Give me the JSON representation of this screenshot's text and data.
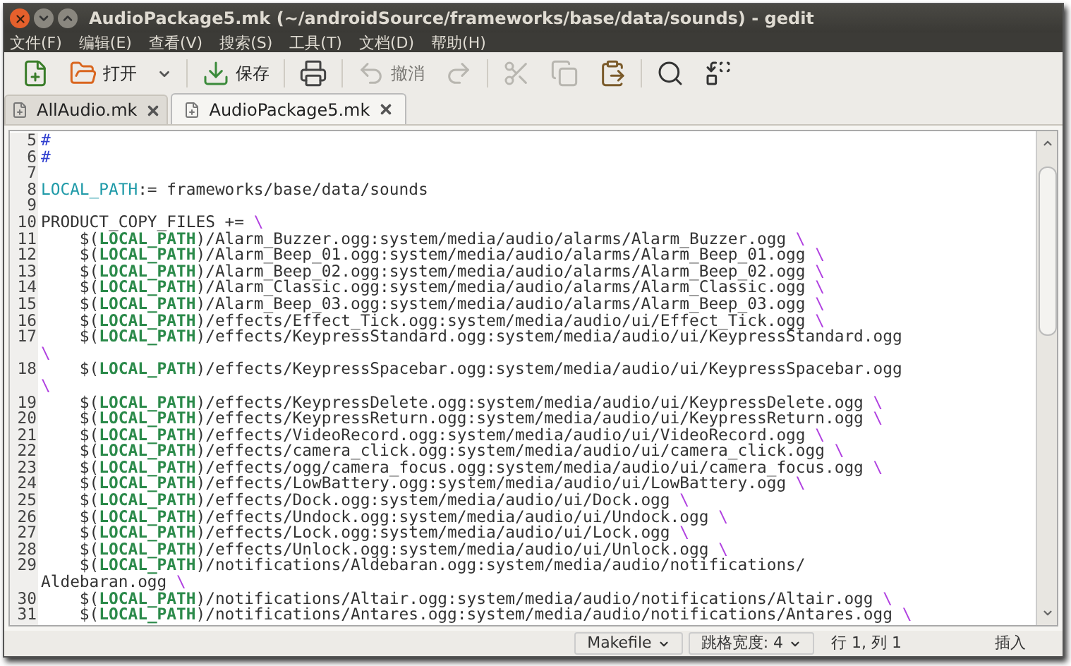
{
  "window": {
    "title": "AudioPackage5.mk (~/androidSource/frameworks/base/data/sounds) - gedit"
  },
  "menu": [
    "文件(F)",
    "编辑(E)",
    "查看(V)",
    "搜索(S)",
    "工具(T)",
    "文档(D)",
    "帮助(H)"
  ],
  "toolbar": [
    {
      "disabled": false
    },
    {
      "label": "打开",
      "disabled": false
    },
    {
      "disabled": false
    },
    {
      "label": "保存",
      "disabled": false
    },
    {
      "disabled": false
    },
    {
      "label": "撤消",
      "disabled": true
    },
    {
      "disabled": true
    },
    {
      "disabled": true
    },
    {
      "disabled": true
    },
    {
      "disabled": false
    },
    {
      "disabled": false
    },
    {
      "disabled": false
    }
  ],
  "tabs": [
    {
      "label": "AllAudio.mk",
      "selected": false
    },
    {
      "label": "AudioPackage5.mk",
      "selected": true
    }
  ],
  "editor": {
    "rows": [
      {
        "number": "5",
        "segments": [
          {
            "kind": "comment",
            "text": "#"
          }
        ]
      },
      {
        "number": "6",
        "segments": [
          {
            "kind": "comment",
            "text": "#"
          }
        ]
      },
      {
        "number": "7",
        "segments": []
      },
      {
        "number": "8",
        "segments": [
          {
            "kind": "variable",
            "text": "LOCAL_PATH"
          },
          {
            "kind": "plain",
            "text": ":= frameworks/base/data/sounds"
          }
        ]
      },
      {
        "number": "9",
        "segments": []
      },
      {
        "number": "10",
        "segments": [
          {
            "kind": "plain",
            "text": "PRODUCT_COPY_FILES += "
          },
          {
            "kind": "escape",
            "text": "\\"
          }
        ]
      },
      {
        "number": "11",
        "segments": [
          {
            "kind": "plain",
            "text": "    $("
          },
          {
            "kind": "macro",
            "text": "LOCAL_PATH"
          },
          {
            "kind": "plain",
            "text": ")/Alarm_Buzzer.ogg:system/media/audio/alarms/Alarm_Buzzer.ogg "
          },
          {
            "kind": "escape",
            "text": "\\"
          }
        ]
      },
      {
        "number": "12",
        "segments": [
          {
            "kind": "plain",
            "text": "    $("
          },
          {
            "kind": "macro",
            "text": "LOCAL_PATH"
          },
          {
            "kind": "plain",
            "text": ")/Alarm_Beep_01.ogg:system/media/audio/alarms/Alarm_Beep_01.ogg "
          },
          {
            "kind": "escape",
            "text": "\\"
          }
        ]
      },
      {
        "number": "13",
        "segments": [
          {
            "kind": "plain",
            "text": "    $("
          },
          {
            "kind": "macro",
            "text": "LOCAL_PATH"
          },
          {
            "kind": "plain",
            "text": ")/Alarm_Beep_02.ogg:system/media/audio/alarms/Alarm_Beep_02.ogg "
          },
          {
            "kind": "escape",
            "text": "\\"
          }
        ]
      },
      {
        "number": "14",
        "segments": [
          {
            "kind": "plain",
            "text": "    $("
          },
          {
            "kind": "macro",
            "text": "LOCAL_PATH"
          },
          {
            "kind": "plain",
            "text": ")/Alarm_Classic.ogg:system/media/audio/alarms/Alarm_Classic.ogg "
          },
          {
            "kind": "escape",
            "text": "\\"
          }
        ]
      },
      {
        "number": "15",
        "segments": [
          {
            "kind": "plain",
            "text": "    $("
          },
          {
            "kind": "macro",
            "text": "LOCAL_PATH"
          },
          {
            "kind": "plain",
            "text": ")/Alarm_Beep_03.ogg:system/media/audio/alarms/Alarm_Beep_03.ogg "
          },
          {
            "kind": "escape",
            "text": "\\"
          }
        ]
      },
      {
        "number": "16",
        "segments": [
          {
            "kind": "plain",
            "text": "    $("
          },
          {
            "kind": "macro",
            "text": "LOCAL_PATH"
          },
          {
            "kind": "plain",
            "text": ")/effects/Effect_Tick.ogg:system/media/audio/ui/Effect_Tick.ogg "
          },
          {
            "kind": "escape",
            "text": "\\"
          }
        ]
      },
      {
        "number": "17",
        "segments": [
          {
            "kind": "plain",
            "text": "    $("
          },
          {
            "kind": "macro",
            "text": "LOCAL_PATH"
          },
          {
            "kind": "plain",
            "text": ")/effects/KeypressStandard.ogg:system/media/audio/ui/KeypressStandard.ogg"
          }
        ]
      },
      {
        "segments": [
          {
            "kind": "escape",
            "text": "\\"
          }
        ]
      },
      {
        "number": "18",
        "segments": [
          {
            "kind": "plain",
            "text": "    $("
          },
          {
            "kind": "macro",
            "text": "LOCAL_PATH"
          },
          {
            "kind": "plain",
            "text": ")/effects/KeypressSpacebar.ogg:system/media/audio/ui/KeypressSpacebar.ogg"
          }
        ]
      },
      {
        "segments": [
          {
            "kind": "escape",
            "text": "\\"
          }
        ]
      },
      {
        "number": "19",
        "segments": [
          {
            "kind": "plain",
            "text": "    $("
          },
          {
            "kind": "macro",
            "text": "LOCAL_PATH"
          },
          {
            "kind": "plain",
            "text": ")/effects/KeypressDelete.ogg:system/media/audio/ui/KeypressDelete.ogg "
          },
          {
            "kind": "escape",
            "text": "\\"
          }
        ]
      },
      {
        "number": "20",
        "segments": [
          {
            "kind": "plain",
            "text": "    $("
          },
          {
            "kind": "macro",
            "text": "LOCAL_PATH"
          },
          {
            "kind": "plain",
            "text": ")/effects/KeypressReturn.ogg:system/media/audio/ui/KeypressReturn.ogg "
          },
          {
            "kind": "escape",
            "text": "\\"
          }
        ]
      },
      {
        "number": "21",
        "segments": [
          {
            "kind": "plain",
            "text": "    $("
          },
          {
            "kind": "macro",
            "text": "LOCAL_PATH"
          },
          {
            "kind": "plain",
            "text": ")/effects/VideoRecord.ogg:system/media/audio/ui/VideoRecord.ogg "
          },
          {
            "kind": "escape",
            "text": "\\"
          }
        ]
      },
      {
        "number": "22",
        "segments": [
          {
            "kind": "plain",
            "text": "    $("
          },
          {
            "kind": "macro",
            "text": "LOCAL_PATH"
          },
          {
            "kind": "plain",
            "text": ")/effects/camera_click.ogg:system/media/audio/ui/camera_click.ogg "
          },
          {
            "kind": "escape",
            "text": "\\"
          }
        ]
      },
      {
        "number": "23",
        "segments": [
          {
            "kind": "plain",
            "text": "    $("
          },
          {
            "kind": "macro",
            "text": "LOCAL_PATH"
          },
          {
            "kind": "plain",
            "text": ")/effects/ogg/camera_focus.ogg:system/media/audio/ui/camera_focus.ogg "
          },
          {
            "kind": "escape",
            "text": "\\"
          }
        ]
      },
      {
        "number": "24",
        "segments": [
          {
            "kind": "plain",
            "text": "    $("
          },
          {
            "kind": "macro",
            "text": "LOCAL_PATH"
          },
          {
            "kind": "plain",
            "text": ")/effects/LowBattery.ogg:system/media/audio/ui/LowBattery.ogg "
          },
          {
            "kind": "escape",
            "text": "\\"
          }
        ]
      },
      {
        "number": "25",
        "segments": [
          {
            "kind": "plain",
            "text": "    $("
          },
          {
            "kind": "macro",
            "text": "LOCAL_PATH"
          },
          {
            "kind": "plain",
            "text": ")/effects/Dock.ogg:system/media/audio/ui/Dock.ogg "
          },
          {
            "kind": "escape",
            "text": "\\"
          }
        ]
      },
      {
        "number": "26",
        "segments": [
          {
            "kind": "plain",
            "text": "    $("
          },
          {
            "kind": "macro",
            "text": "LOCAL_PATH"
          },
          {
            "kind": "plain",
            "text": ")/effects/Undock.ogg:system/media/audio/ui/Undock.ogg "
          },
          {
            "kind": "escape",
            "text": "\\"
          }
        ]
      },
      {
        "number": "27",
        "segments": [
          {
            "kind": "plain",
            "text": "    $("
          },
          {
            "kind": "macro",
            "text": "LOCAL_PATH"
          },
          {
            "kind": "plain",
            "text": ")/effects/Lock.ogg:system/media/audio/ui/Lock.ogg "
          },
          {
            "kind": "escape",
            "text": "\\"
          }
        ]
      },
      {
        "number": "28",
        "segments": [
          {
            "kind": "plain",
            "text": "    $("
          },
          {
            "kind": "macro",
            "text": "LOCAL_PATH"
          },
          {
            "kind": "plain",
            "text": ")/effects/Unlock.ogg:system/media/audio/ui/Unlock.ogg "
          },
          {
            "kind": "escape",
            "text": "\\"
          }
        ]
      },
      {
        "number": "29",
        "segments": [
          {
            "kind": "plain",
            "text": "    $("
          },
          {
            "kind": "macro",
            "text": "LOCAL_PATH"
          },
          {
            "kind": "plain",
            "text": ")/notifications/Aldebaran.ogg:system/media/audio/notifications/"
          }
        ]
      },
      {
        "segments": [
          {
            "kind": "plain",
            "text": "Aldebaran.ogg "
          },
          {
            "kind": "escape",
            "text": "\\"
          }
        ]
      },
      {
        "number": "30",
        "segments": [
          {
            "kind": "plain",
            "text": "    $("
          },
          {
            "kind": "macro",
            "text": "LOCAL_PATH"
          },
          {
            "kind": "plain",
            "text": ")/notifications/Altair.ogg:system/media/audio/notifications/Altair.ogg "
          },
          {
            "kind": "escape",
            "text": "\\"
          }
        ]
      },
      {
        "number": "31",
        "segments": [
          {
            "kind": "plain",
            "text": "    $("
          },
          {
            "kind": "macro",
            "text": "LOCAL_PATH"
          },
          {
            "kind": "plain",
            "text": ")/notifications/Antares.ogg:system/media/audio/notifications/Antares.ogg "
          },
          {
            "kind": "escape",
            "text": "\\"
          }
        ]
      }
    ]
  },
  "status_bar": [
    {
      "label": "Makefile",
      "dropdown": true
    },
    {
      "label": "跳格宽度: 4",
      "dropdown": true
    },
    {
      "label": "行 1, 列 1",
      "dropdown": false
    },
    {
      "label": "插入",
      "dropdown": false
    }
  ]
}
